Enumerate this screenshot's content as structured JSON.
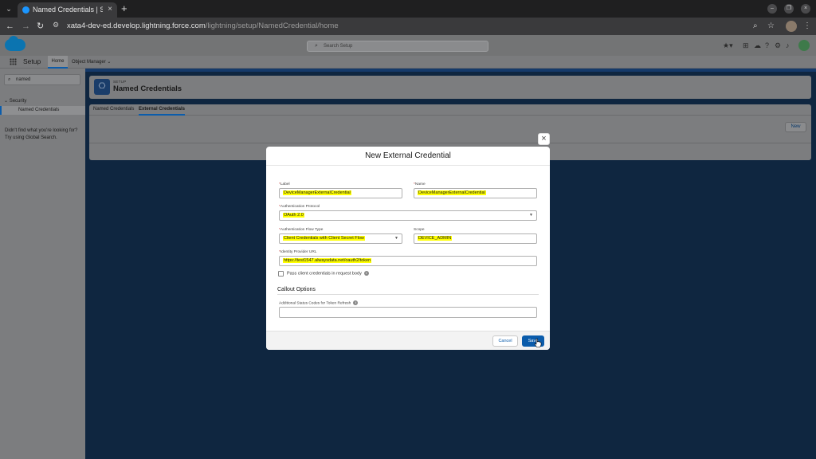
{
  "browser": {
    "tab_title": "Named Credentials | Sal",
    "url_host": "xata4-dev-ed.develop.lightning.force.com",
    "url_path": "/lightning/setup/NamedCredential/home"
  },
  "header": {
    "search_placeholder": "Search Setup"
  },
  "subnav": {
    "app_name": "Setup",
    "tabs": [
      {
        "label": "Home"
      },
      {
        "label": "Object Manager"
      }
    ]
  },
  "sidebar": {
    "quickfind_value": "named",
    "section": "Security",
    "item": "Named Credentials",
    "help_text": "Didn't find what you're looking for? Try using Global Search."
  },
  "page": {
    "eyebrow": "SETUP",
    "title": "Named Credentials",
    "tabs": [
      {
        "label": "Named Credentials"
      },
      {
        "label": "External Credentials"
      }
    ],
    "new_button": "New"
  },
  "modal": {
    "title": "New External Credential",
    "fields": {
      "label": {
        "label": "Label",
        "value": "DeviceManagerExternalCredential"
      },
      "name": {
        "label": "Name",
        "value": "DeviceManagerExternalCredential"
      },
      "auth_protocol": {
        "label": "Authentication Protocol",
        "value": "OAuth 2.0"
      },
      "auth_flow": {
        "label": "Authentication Flow Type",
        "value": "Client Credentials with Client Secret Flow"
      },
      "scope": {
        "label": "Scope",
        "value": "DEVICE_ADMIN"
      },
      "idp_url": {
        "label": "Identity Provider URL",
        "value": "https://test1547.alwaysdata.net/oauth2/token"
      },
      "pass_creds": {
        "label": "Pass client credentials in request body"
      },
      "status_codes": {
        "label": "Additional Status Codes for Token Refresh",
        "value": ""
      }
    },
    "section_title": "Callout Options",
    "cancel_label": "Cancel",
    "save_label": "Save"
  }
}
